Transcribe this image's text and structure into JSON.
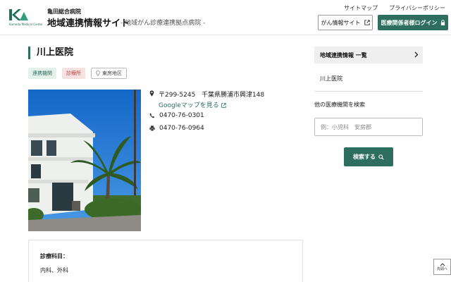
{
  "header": {
    "logo_text": "Kameda Medical Center",
    "hospital_name": "亀田総合病院",
    "site_title": "地域連携情報サイト",
    "site_subtitle": "- 地域がん診療連携拠点病院 -",
    "top_links": [
      "サイトマップ",
      "プライバシーポリシー"
    ],
    "cancer_info_button": "がん情報サイト",
    "login_button": "医療関係者様ログイン",
    "brand_color": "#2e6e5f"
  },
  "clinic": {
    "name": "川上医院",
    "tags": [
      "連携機関",
      "診療所",
      "東房地区"
    ],
    "postal": "〒299-5245",
    "address": "千葉県勝浦市興津148",
    "map_link": "Googleマップを見る",
    "tel": "0470-76-0301",
    "fax": "0470-76-0964",
    "dept_heading": "診療科目：",
    "departments": "内科、外科"
  },
  "sidebar": {
    "nav_heading": "地域連携情報 一覧",
    "nav_item": "川上医院",
    "search_label": "他の医療機関を検索",
    "search_placeholder": "例：小児科　安房郡",
    "search_button": "検索する"
  },
  "to_top": "先頭へ"
}
